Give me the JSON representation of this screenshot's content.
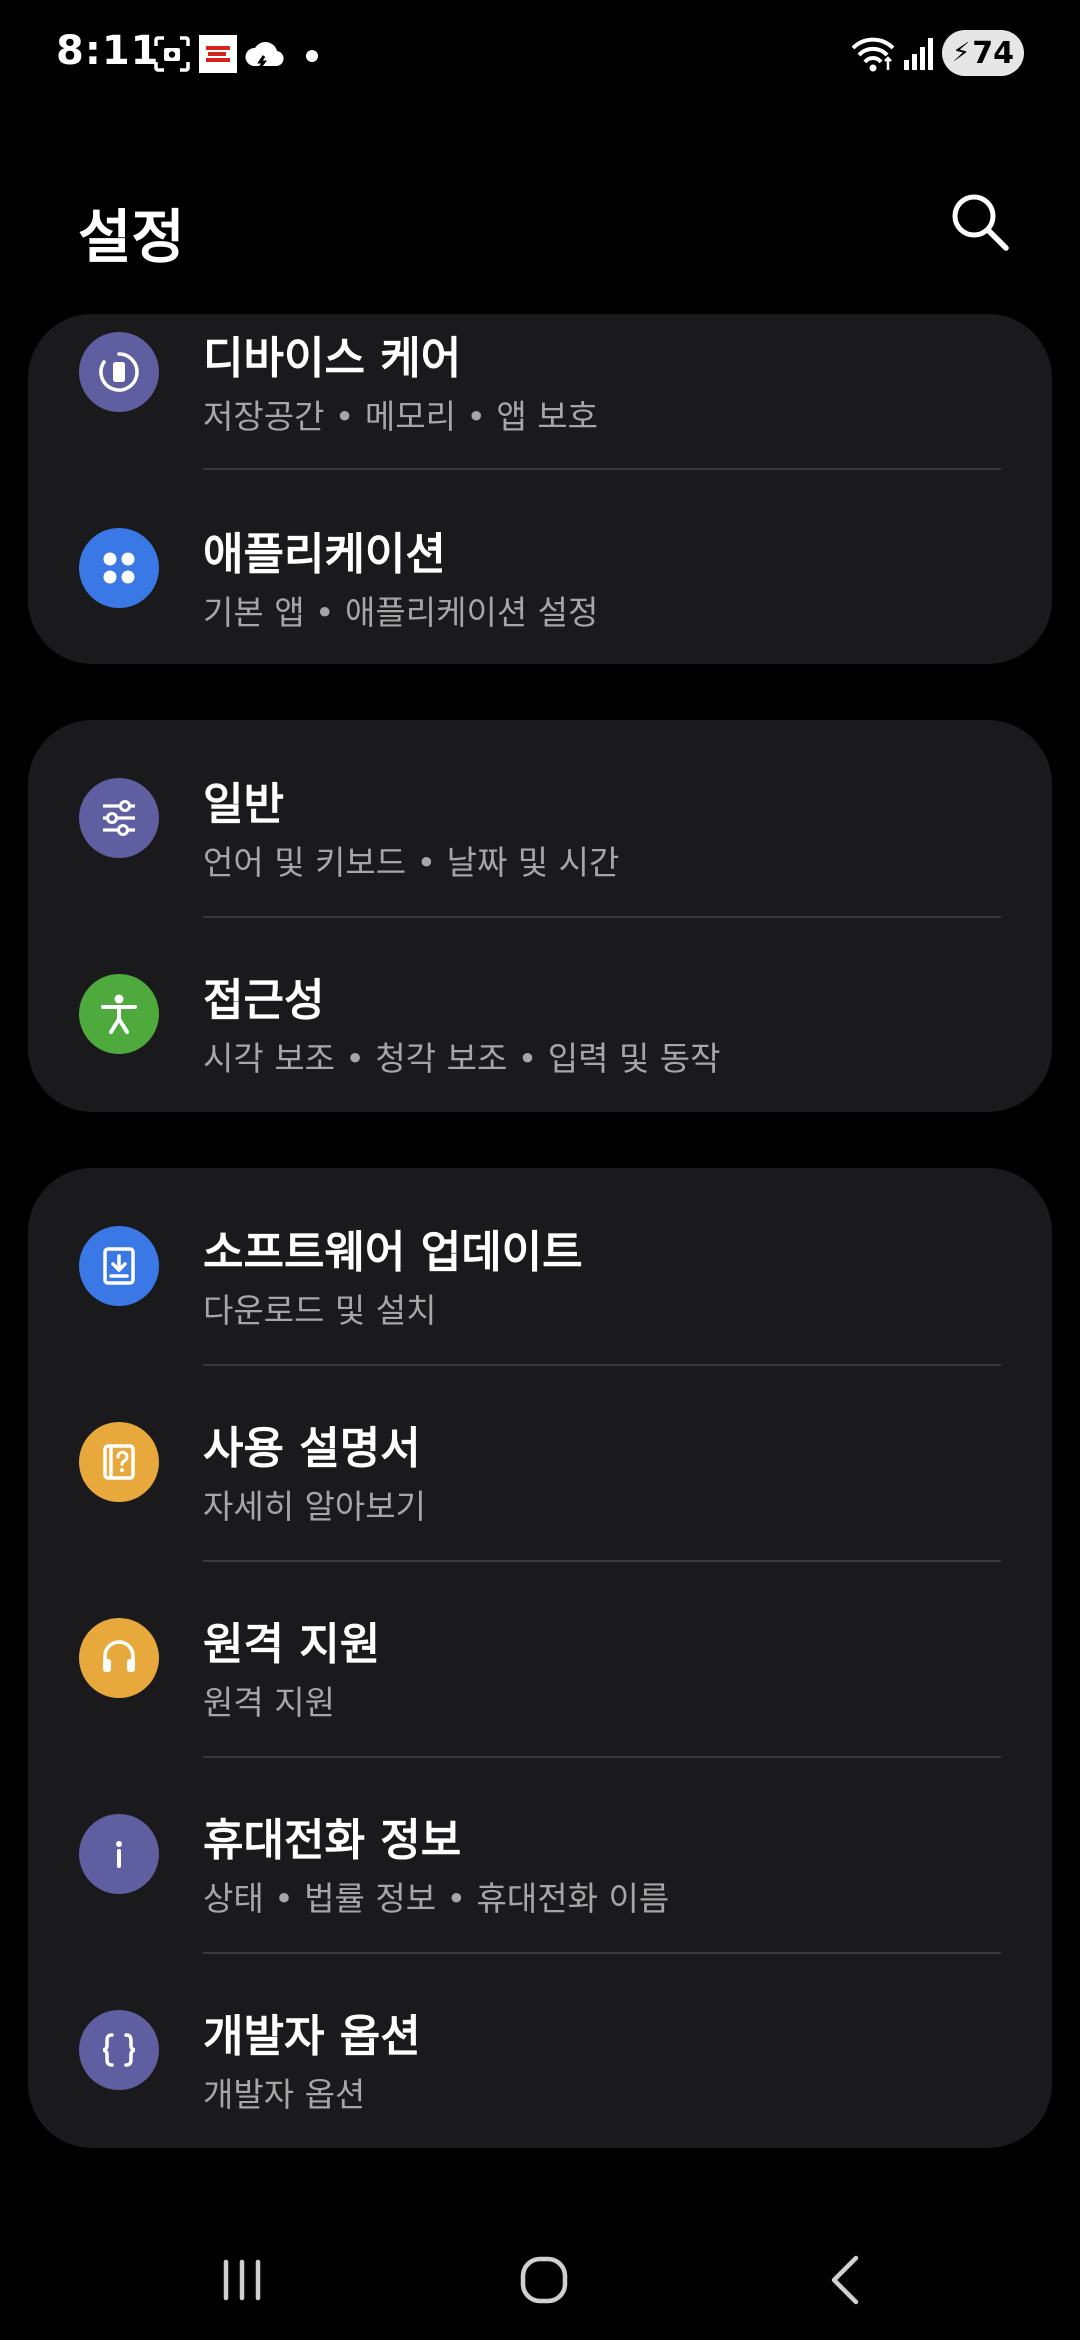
{
  "status_bar": {
    "time": "8:11",
    "battery_level": "74",
    "icons": [
      "screenshot-icon",
      "app-notification-icon",
      "cloud-icon",
      "dot-icon",
      "wifi-icon",
      "signal-icon",
      "battery-charging-icon"
    ]
  },
  "header": {
    "title": "설정",
    "search_icon": "search-icon"
  },
  "cards": [
    {
      "items": [
        {
          "title": "디바이스 케어",
          "subtitle": "저장공간 • 메모리 • 앱 보호",
          "icon": "device-care-icon",
          "color": "#5f5ea1"
        },
        {
          "title": "애플리케이션",
          "subtitle": "기본 앱 • 애플리케이션 설정",
          "icon": "apps-icon",
          "color": "#3a78e6"
        }
      ]
    },
    {
      "items": [
        {
          "title": "일반",
          "subtitle": "언어 및 키보드 • 날짜 및 시간",
          "icon": "sliders-icon",
          "color": "#5f5ea1"
        },
        {
          "title": "접근성",
          "subtitle": "시각 보조 • 청각 보조 • 입력 및 동작",
          "icon": "accessibility-icon",
          "color": "#4faa3e"
        }
      ]
    },
    {
      "items": [
        {
          "title": "소프트웨어 업데이트",
          "subtitle": "다운로드 및 설치",
          "icon": "software-update-icon",
          "color": "#3a78e6"
        },
        {
          "title": "사용 설명서",
          "subtitle": "자세히 알아보기",
          "icon": "user-manual-icon",
          "color": "#e8a93c"
        },
        {
          "title": "원격 지원",
          "subtitle": "원격 지원",
          "icon": "headset-icon",
          "color": "#e8a93c"
        },
        {
          "title": "휴대전화 정보",
          "subtitle": "상태 • 법률 정보 • 휴대전화 이름",
          "icon": "info-icon",
          "color": "#5f5ea1"
        },
        {
          "title": "개발자 옵션",
          "subtitle": "개발자 옵션",
          "icon": "developer-options-icon",
          "color": "#5f5ea1"
        }
      ]
    }
  ],
  "nav_bar": {
    "recents_icon": "recents-icon",
    "home_icon": "home-icon",
    "back_icon": "back-icon"
  }
}
